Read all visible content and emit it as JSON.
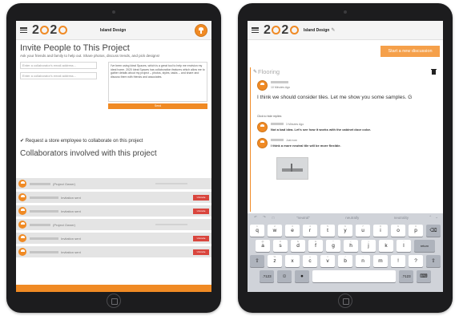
{
  "left_screen": {
    "brand": "Island Design",
    "title": "Invite People to This Project",
    "subtitle": "Ask your friends and family to help out. Share photos, discuss trends, and pick designs!",
    "email_placeholder_1": "Enter a collaborator's email address...",
    "email_placeholder_2": "Enter a collaborator's email address...",
    "message_text": "I've been using Ideal Spaces, which is a great tool to help me envision my ideal home.\n\n2020 Ideal Spaces has collaboration features which allow me to gather details about my project -- photos, styles, tasks -- and share and discuss them with friends and associates.",
    "send_label": "Send",
    "request_label": "✔ Request a store employee to collaborate on this project",
    "collaborators_title": "Collaborators involved with this project",
    "rows": [
      {
        "status": "(Project Owner)",
        "action": ""
      },
      {
        "status": "Invitation sent",
        "action": "Uninvite"
      },
      {
        "status": "Invitation sent",
        "action": "Uninvite"
      },
      {
        "status": "(Project Owner)",
        "action": ""
      },
      {
        "status": "Invitation sent",
        "action": "Uninvite"
      },
      {
        "status": "Invitation sent",
        "action": "Uninvite"
      }
    ]
  },
  "right_screen": {
    "brand": "Island Design",
    "start_discussion": "Start a new discussion",
    "thread_title": "Flooring",
    "post_time": "10 Minutes Ago",
    "post_text": "I think we should consider tiles. Let me show you some samples. G",
    "hide_replies": "Click to hide replies",
    "reply1_time": "3 Minutes Ago",
    "reply1_text": "Not a bad idea. Let's see how it works with the cabinet door color.",
    "reply2_time": "Just now",
    "reply2_text": "I think a more neutral tile will be more flexible."
  },
  "keyboard": {
    "suggestions": [
      "\"neutral\"",
      "neutrally",
      "neutrality"
    ],
    "row1": [
      "q",
      "w",
      "e",
      "r",
      "t",
      "y",
      "u",
      "i",
      "o",
      "p"
    ],
    "row1_sup": [
      "1",
      "2",
      "3",
      "4",
      "5",
      "6",
      "7",
      "8",
      "9",
      "0"
    ],
    "row2": [
      "a",
      "s",
      "d",
      "f",
      "g",
      "h",
      "j",
      "k",
      "l"
    ],
    "row2_sup": [
      "@",
      "#",
      "$",
      "&",
      "*",
      "(",
      ")",
      "'",
      "\""
    ],
    "row3": [
      "z",
      "x",
      "c",
      "v",
      "b",
      "n",
      "m",
      "!",
      "?"
    ],
    "row3_sup": [
      "%",
      "-",
      "+",
      "=",
      "/",
      ";",
      ":",
      ",",
      "."
    ],
    "return_label": "return",
    "num_label": ".?123",
    "backspace": "⌫",
    "shift": "⇧"
  }
}
